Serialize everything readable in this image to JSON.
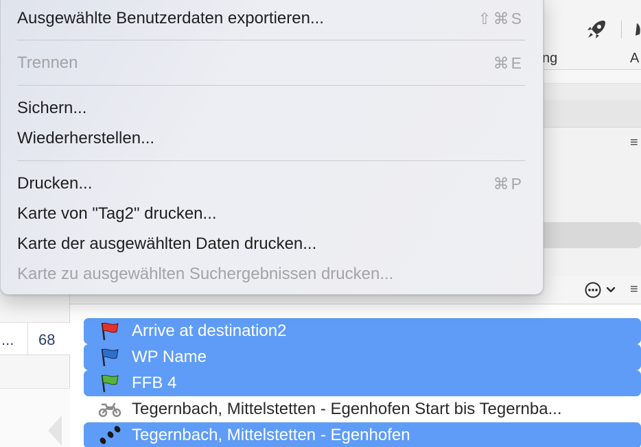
{
  "toolbar": {
    "label_left": "ng",
    "label_right": "A"
  },
  "left_table": {
    "cell_ellipsis": "...",
    "cell_value": "68"
  },
  "list": {
    "rows": [
      {
        "label": "Arrive at destination2",
        "icon": "red-flag-icon",
        "icon_color": "#e3322a",
        "selected": true
      },
      {
        "label": "WP Name",
        "icon": "blue-flag-icon",
        "icon_color": "#2f6fc9",
        "selected": true
      },
      {
        "label": "FFB 4",
        "icon": "green-flag-icon",
        "icon_color": "#57b43a",
        "selected": true
      },
      {
        "label": "Tegernbach, Mittelstetten - Egenhofen Start bis Tegernba...",
        "icon": "motorcycle-icon",
        "icon_color": "#8a8a8a",
        "selected": false
      },
      {
        "label": "Tegernbach, Mittelstetten - Egenhofen",
        "icon": "footprints-icon",
        "icon_color": "#1a1a1a",
        "selected": true
      }
    ]
  },
  "menu": {
    "export": {
      "label": "Ausgewählte Benutzerdaten exportieren...",
      "shortcut": "⇧⌘S"
    },
    "separate": {
      "label": "Trennen",
      "shortcut": "⌘E"
    },
    "backup": {
      "label": "Sichern..."
    },
    "restore": {
      "label": "Wiederherstellen..."
    },
    "print": {
      "label": "Drucken...",
      "shortcut": "⌘P"
    },
    "print_map_day": {
      "label": "Karte von \"Tag2\" drucken..."
    },
    "print_map_selected": {
      "label": "Karte der ausgewählten Daten drucken..."
    },
    "print_map_search": {
      "label": "Karte zu ausgewählten Suchergebnissen drucken..."
    }
  },
  "colors": {
    "selection": "#5f9cf8",
    "menu_bg": "#eceef3",
    "disabled_text": "#a3a3a8"
  }
}
